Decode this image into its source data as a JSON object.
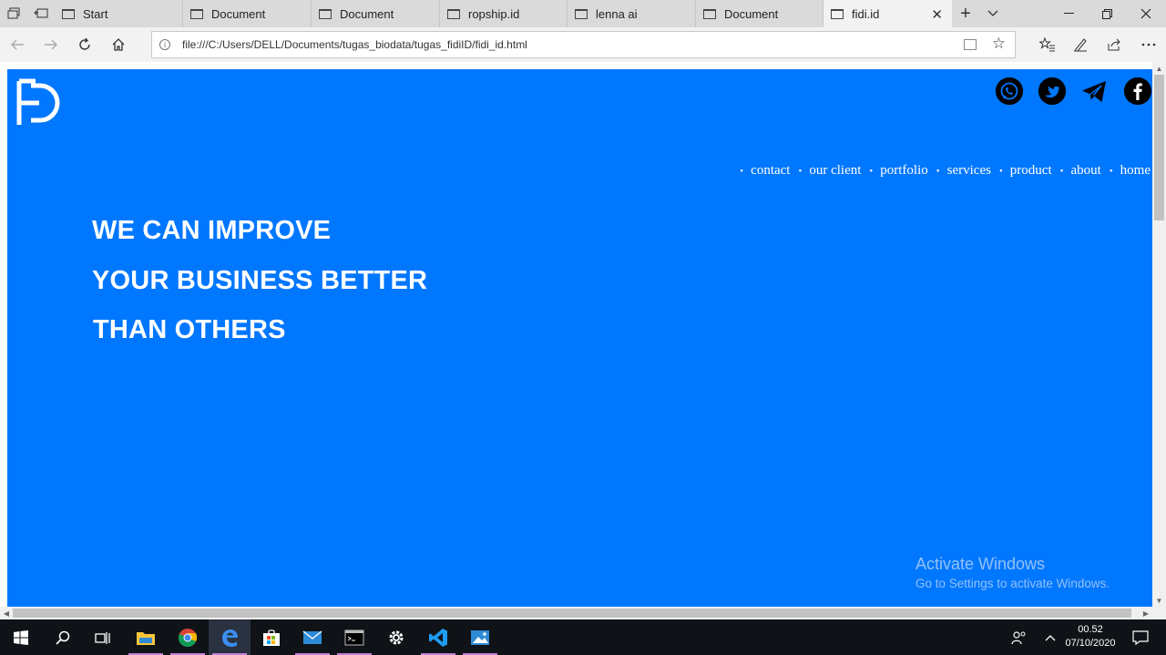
{
  "browser": {
    "tabs": [
      {
        "label": "Start",
        "active": false
      },
      {
        "label": "Document",
        "active": false
      },
      {
        "label": "Document",
        "active": false
      },
      {
        "label": "ropship.id",
        "active": false
      },
      {
        "label": "lenna ai",
        "active": false
      },
      {
        "label": "Document",
        "active": false
      },
      {
        "label": "fidi.id",
        "active": true
      }
    ],
    "url": "file:///C:/Users/DELL/Documents/tugas_biodata/tugas_fidiID/fidi_id.html"
  },
  "site": {
    "logo_icon": "fd-logo",
    "social_icons": [
      "whatsapp-icon",
      "twitter-icon",
      "telegram-icon",
      "facebook-icon"
    ],
    "nav": [
      "contact",
      "our client",
      "portfolio",
      "services",
      "product",
      "about",
      "home"
    ],
    "hero": [
      "WE CAN IMPROVE",
      "YOUR BUSINESS BETTER",
      "THAN OTHERS"
    ],
    "colors": {
      "background": "#0077ff",
      "text": "#ffffff"
    }
  },
  "watermark": {
    "title": "Activate Windows",
    "subtitle": "Go to Settings to activate Windows."
  },
  "taskbar": {
    "time": "00.52",
    "date": "07/10/2020",
    "apps": [
      "start-icon",
      "search-icon",
      "task-view-icon",
      "file-explorer-icon",
      "chrome-icon",
      "edge-icon",
      "store-icon",
      "mail-icon",
      "terminal-icon",
      "settings-icon",
      "vscode-icon",
      "photos-icon"
    ]
  }
}
